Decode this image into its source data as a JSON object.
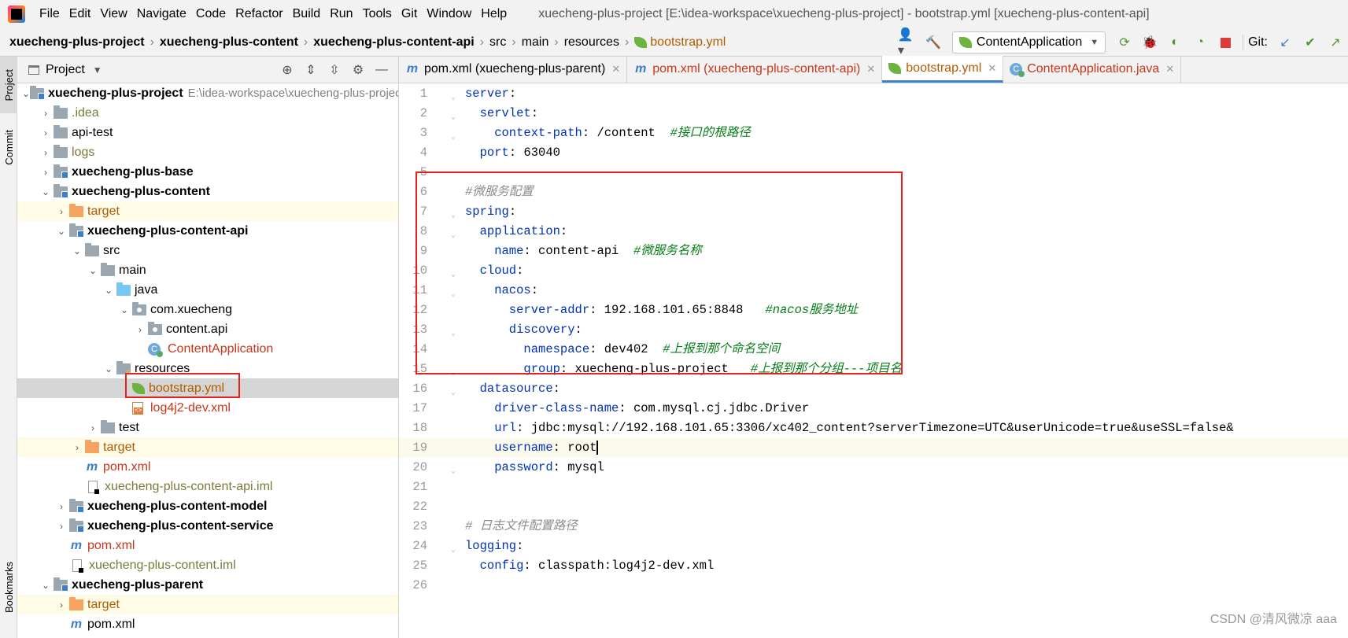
{
  "menu": {
    "items": [
      "File",
      "Edit",
      "View",
      "Navigate",
      "Code",
      "Refactor",
      "Build",
      "Run",
      "Tools",
      "Git",
      "Window",
      "Help"
    ],
    "window_title": "xuecheng-plus-project [E:\\idea-workspace\\xuecheng-plus-project] - bootstrap.yml [xuecheng-plus-content-api]"
  },
  "breadcrumb": [
    "xuecheng-plus-project",
    "xuecheng-plus-content",
    "xuecheng-plus-content-api",
    "src",
    "main",
    "resources",
    "bootstrap.yml"
  ],
  "toolbar": {
    "run_config": "ContentApplication",
    "git_label": "Git:"
  },
  "side_tabs": {
    "project": "Project",
    "commit": "Commit",
    "bookmarks": "Bookmarks"
  },
  "project_panel": {
    "title": "Project",
    "tree": [
      {
        "label": "xuecheng-plus-project",
        "path": "E:\\idea-workspace\\xuecheng-plus-project"
      },
      {
        "label": ".idea"
      },
      {
        "label": "api-test"
      },
      {
        "label": "logs"
      },
      {
        "label": "xuecheng-plus-base"
      },
      {
        "label": "xuecheng-plus-content"
      },
      {
        "label": "target"
      },
      {
        "label": "xuecheng-plus-content-api"
      },
      {
        "label": "src"
      },
      {
        "label": "main"
      },
      {
        "label": "java"
      },
      {
        "label": "com.xuecheng"
      },
      {
        "label": "content.api"
      },
      {
        "label": "ContentApplication"
      },
      {
        "label": "resources"
      },
      {
        "label": "bootstrap.yml"
      },
      {
        "label": "log4j2-dev.xml"
      },
      {
        "label": "test"
      },
      {
        "label": "target"
      },
      {
        "label": "pom.xml"
      },
      {
        "label": "xuecheng-plus-content-api.iml"
      },
      {
        "label": "xuecheng-plus-content-model"
      },
      {
        "label": "xuecheng-plus-content-service"
      },
      {
        "label": "pom.xml"
      },
      {
        "label": "xuecheng-plus-content.iml"
      },
      {
        "label": "xuecheng-plus-parent"
      },
      {
        "label": "target"
      },
      {
        "label": "pom.xml"
      }
    ]
  },
  "tabs": [
    {
      "label": "pom.xml (xuecheng-plus-parent)"
    },
    {
      "label": "pom.xml (xuecheng-plus-content-api)"
    },
    {
      "label": "bootstrap.yml"
    },
    {
      "label": "ContentApplication.java"
    }
  ],
  "code": {
    "lines": [
      {
        "n": "1",
        "key": "server",
        "sep": ":",
        "val": "",
        "comment": ""
      },
      {
        "n": "2",
        "key": "  servlet",
        "sep": ":",
        "val": "",
        "comment": ""
      },
      {
        "n": "3",
        "key": "    context-path",
        "sep": ": ",
        "val": "/content  ",
        "comment": "#接口的根路径"
      },
      {
        "n": "4",
        "key": "  port",
        "sep": ": ",
        "val": "63040",
        "comment": ""
      },
      {
        "n": "5",
        "key": "",
        "sep": "",
        "val": "",
        "comment": ""
      },
      {
        "n": "6",
        "key": "",
        "sep": "",
        "val": "",
        "comment": "#微服务配置"
      },
      {
        "n": "7",
        "key": "spring",
        "sep": ":",
        "val": "",
        "comment": ""
      },
      {
        "n": "8",
        "key": "  application",
        "sep": ":",
        "val": "",
        "comment": ""
      },
      {
        "n": "9",
        "key": "    name",
        "sep": ": ",
        "val": "content-api  ",
        "comment": "#微服务名称"
      },
      {
        "n": "10",
        "key": "  cloud",
        "sep": ":",
        "val": "",
        "comment": ""
      },
      {
        "n": "11",
        "key": "    nacos",
        "sep": ":",
        "val": "",
        "comment": ""
      },
      {
        "n": "12",
        "key": "      server-addr",
        "sep": ": ",
        "val": "192.168.101.65:8848   ",
        "comment": "#nacos服务地址"
      },
      {
        "n": "13",
        "key": "      discovery",
        "sep": ":",
        "val": "",
        "comment": ""
      },
      {
        "n": "14",
        "key": "        namespace",
        "sep": ": ",
        "val": "dev402  ",
        "comment": "#上报到那个命名空间"
      },
      {
        "n": "15",
        "key": "        group",
        "sep": ": ",
        "val": "xuecheng-plus-project   ",
        "comment": "#上报到那个分组---项目名"
      },
      {
        "n": "16",
        "key": "  datasource",
        "sep": ":",
        "val": "",
        "comment": ""
      },
      {
        "n": "17",
        "key": "    driver-class-name",
        "sep": ": ",
        "val": "com.mysql.cj.jdbc.Driver",
        "comment": ""
      },
      {
        "n": "18",
        "key": "    url",
        "sep": ": ",
        "val": "jdbc:mysql://192.168.101.65:3306/xc402_content?serverTimezone=UTC&userUnicode=true&useSSL=false&",
        "comment": ""
      },
      {
        "n": "19",
        "key": "    username",
        "sep": ": ",
        "val": "root",
        "comment": ""
      },
      {
        "n": "20",
        "key": "    password",
        "sep": ": ",
        "val": "mysql",
        "comment": ""
      },
      {
        "n": "21",
        "key": "",
        "sep": "",
        "val": "",
        "comment": ""
      },
      {
        "n": "22",
        "key": "",
        "sep": "",
        "val": "",
        "comment": ""
      },
      {
        "n": "23",
        "key": "",
        "sep": "",
        "val": "",
        "comment": "# 日志文件配置路径"
      },
      {
        "n": "24",
        "key": "logging",
        "sep": ":",
        "val": "",
        "comment": ""
      },
      {
        "n": "25",
        "key": "  config",
        "sep": ": ",
        "val": "classpath:log4j2-dev.xml",
        "comment": ""
      },
      {
        "n": "26",
        "key": "",
        "sep": "",
        "val": "",
        "comment": ""
      }
    ]
  },
  "watermark": "CSDN @清风微凉 aaa",
  "colors": {
    "highlight_box": "#e5221e",
    "tab_active_underline": "#4083c9",
    "yaml_key": "#0033b3",
    "comment_gray": "#8c8c8c",
    "comment_green": "#067d17"
  }
}
